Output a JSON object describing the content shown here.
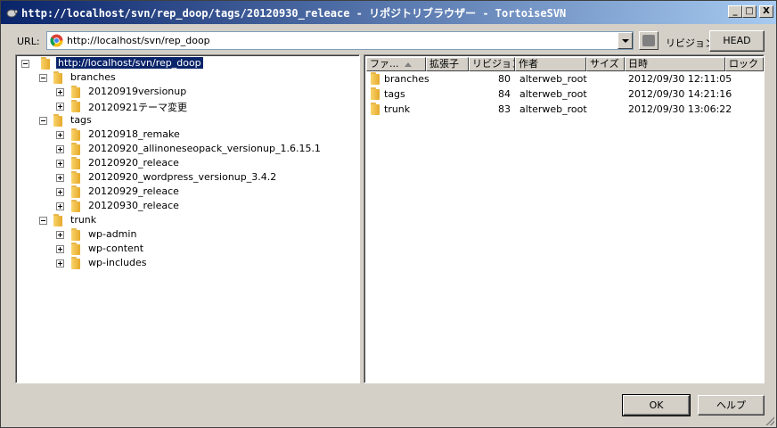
{
  "window": {
    "title": "http://localhost/svn/rep_doop/tags/20120930_releace - リポジトリブラウザー - TortoiseSVN",
    "minimize_label": "_",
    "maximize_label": "□",
    "close_label": "X"
  },
  "url_bar": {
    "label": "URL:",
    "value": "http://localhost/svn/rep_doop",
    "revision_label": "リビジョン:",
    "head_label": "HEAD"
  },
  "tree": [
    {
      "label": "http://localhost/svn/rep_doop",
      "expander": "minus",
      "selected": true
    },
    {
      "label": "branches",
      "expander": "minus"
    },
    {
      "label": "20120919versionup",
      "expander": "plus"
    },
    {
      "label": "20120921テーマ変更",
      "expander": "plus"
    },
    {
      "label": "tags",
      "expander": "minus"
    },
    {
      "label": "20120918_remake",
      "expander": "plus"
    },
    {
      "label": "20120920_allinoneseopack_versionup_1.6.15.1",
      "expander": "plus"
    },
    {
      "label": "20120920_releace",
      "expander": "plus"
    },
    {
      "label": "20120920_wordpress_versionup_3.4.2",
      "expander": "plus"
    },
    {
      "label": "20120929_releace",
      "expander": "plus"
    },
    {
      "label": "20120930_releace",
      "expander": "plus"
    },
    {
      "label": "trunk",
      "expander": "minus"
    },
    {
      "label": "wp-admin",
      "expander": "plus"
    },
    {
      "label": "wp-content",
      "expander": "plus"
    },
    {
      "label": "wp-includes",
      "expander": "plus"
    }
  ],
  "list": {
    "columns": {
      "file": "ファ...",
      "ext": "拡張子",
      "revision": "リビジョン",
      "author": "作者",
      "size": "サイズ",
      "date": "日時",
      "lock": "ロック"
    },
    "rows": [
      {
        "name": "branches",
        "revision": "80",
        "author": "alterweb_root",
        "date": "2012/09/30 12:11:05"
      },
      {
        "name": "tags",
        "revision": "84",
        "author": "alterweb_root",
        "date": "2012/09/30 14:21:16"
      },
      {
        "name": "trunk",
        "revision": "83",
        "author": "alterweb_root",
        "date": "2012/09/30 13:06:22"
      }
    ]
  },
  "buttons": {
    "ok": "OK",
    "help": "ヘルプ"
  }
}
